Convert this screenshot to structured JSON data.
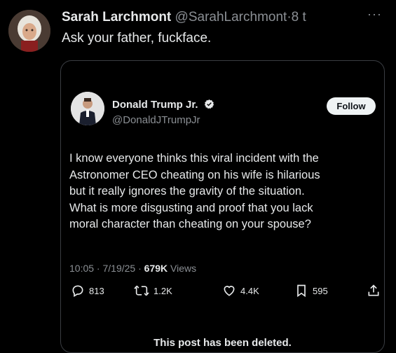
{
  "reply": {
    "author_name": "Sarah Larchmont",
    "author_handle": "@SarahLarchmont",
    "separator": "·",
    "time": "8 t",
    "more": "···",
    "text": "Ask your father, fuckface."
  },
  "quoted_post": {
    "author_name": "Donald Trump Jr.",
    "author_handle": "@DonaldJTrumpJr",
    "follow_label": "Follow",
    "body_lines": [
      "I know everyone thinks this viral incident with the",
      "Astronomer CEO cheating on his wife is hilarious",
      "but it really ignores the gravity of the situation.",
      "What is more disgusting and proof that you lack",
      "moral character than cheating on your spouse?"
    ],
    "time": "10:05",
    "date": "7/19/25",
    "views": "679K",
    "views_label": "Views",
    "replies": "813",
    "reposts": "1.2K",
    "likes": "4.4K",
    "bookmarks": "595",
    "deleted_notice": "This post has been deleted."
  },
  "icons": {
    "reply": "reply-icon",
    "repost": "repost-icon",
    "like": "heart-icon",
    "bookmark": "bookmark-icon",
    "share": "share-icon",
    "verified": "verified-badge-icon"
  },
  "colors": {
    "background": "#000000",
    "text": "#e7e9ea",
    "muted": "#8b8f94",
    "border": "#3a3d42",
    "follow_bg": "#eff3f4"
  }
}
